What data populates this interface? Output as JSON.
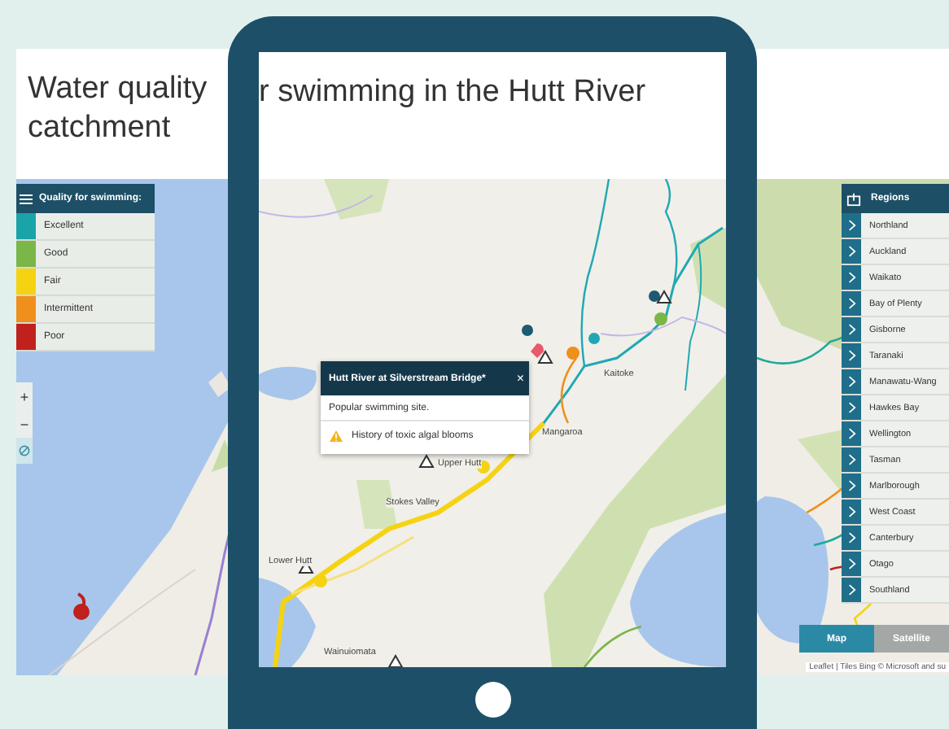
{
  "page": {
    "title_parts": [
      "Water quality",
      "catchment"
    ]
  },
  "legend": {
    "title": "Quality for swimming:",
    "items": [
      {
        "label": "Excellent",
        "color": "#1aa3a8"
      },
      {
        "label": "Good",
        "color": "#7ab648"
      },
      {
        "label": "Fair",
        "color": "#f5d312"
      },
      {
        "label": "Intermittent",
        "color": "#ef8f1c"
      },
      {
        "label": "Poor",
        "color": "#c0201e"
      }
    ]
  },
  "zoom": {
    "zoom_in": "+",
    "zoom_out": "−"
  },
  "regions": {
    "title": "Regions",
    "items": [
      "Northland",
      "Auckland",
      "Waikato",
      "Bay of Plenty",
      "Gisborne",
      "Taranaki",
      "Manawatu-Wang",
      "Hawkes Bay",
      "Wellington",
      "Tasman",
      "Marlborough",
      "West Coast",
      "Canterbury",
      "Otago",
      "Southland"
    ]
  },
  "layers": [
    {
      "label": "Map",
      "selected": true
    },
    {
      "label": "Satellite",
      "selected": false
    }
  ],
  "attribution": "Leaflet | Tiles Bing © Microsoft and su",
  "tablet": {
    "title_fragment": "r swimming in the Hutt River",
    "map_labels": [
      "Kaitoke",
      "Mangaroa",
      "Upper Hutt",
      "Stokes Valley",
      "Lower Hutt",
      "Wainuiomata"
    ],
    "popup": {
      "title": "Hutt River at Silverstream Bridge*",
      "close": "×",
      "description": "Popular swimming site.",
      "warning": "History of toxic algal blooms"
    }
  }
}
